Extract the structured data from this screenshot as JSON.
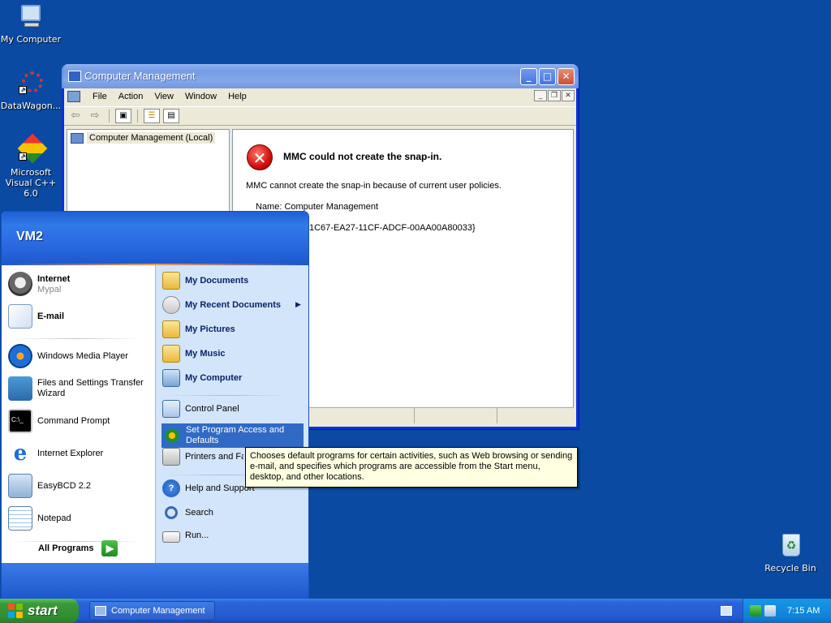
{
  "desktop": {
    "icons": [
      {
        "label": "My Computer"
      },
      {
        "label": "DataWagon..."
      },
      {
        "label": "Microsoft Visual C++ 6.0"
      },
      {
        "label": "Recycle Bin"
      }
    ]
  },
  "window": {
    "title": "Computer Management",
    "menus": [
      "File",
      "Action",
      "View",
      "Window",
      "Help"
    ],
    "tree_root": "Computer Management (Local)",
    "error_title": "MMC could not create the snap-in.",
    "error_body": "MMC cannot create the snap-in because of current user policies.",
    "name_line": "Name: Computer Management",
    "clsid_line": "1C67-EA27-11CF-ADCF-00AA00A80033}"
  },
  "start_menu": {
    "user": "VM2",
    "pinned": [
      {
        "label": "Internet",
        "sub": "Mypal"
      },
      {
        "label": "E-mail"
      }
    ],
    "recent": [
      {
        "label": "Windows Media Player"
      },
      {
        "label": "Files and Settings Transfer Wizard"
      },
      {
        "label": "Command Prompt"
      },
      {
        "label": "Internet Explorer"
      },
      {
        "label": "EasyBCD 2.2"
      },
      {
        "label": "Notepad"
      }
    ],
    "all_programs": "All Programs",
    "places": [
      {
        "label": "My Documents"
      },
      {
        "label": "My Recent Documents"
      },
      {
        "label": "My Pictures"
      },
      {
        "label": "My Music"
      },
      {
        "label": "My Computer"
      }
    ],
    "system": [
      {
        "label": "Control Panel"
      },
      {
        "label": "Set Program Access and Defaults"
      },
      {
        "label": "Printers and Faxes"
      }
    ],
    "help": [
      {
        "label": "Help and Support"
      },
      {
        "label": "Search"
      },
      {
        "label": "Run..."
      }
    ]
  },
  "tooltip": "Chooses default programs for certain activities, such as Web browsing or sending e-mail, and specifies which programs are accessible from the Start menu, desktop, and other locations.",
  "taskbar": {
    "start_label": "start",
    "task_label": "Computer Management",
    "clock": "7:15 AM"
  }
}
